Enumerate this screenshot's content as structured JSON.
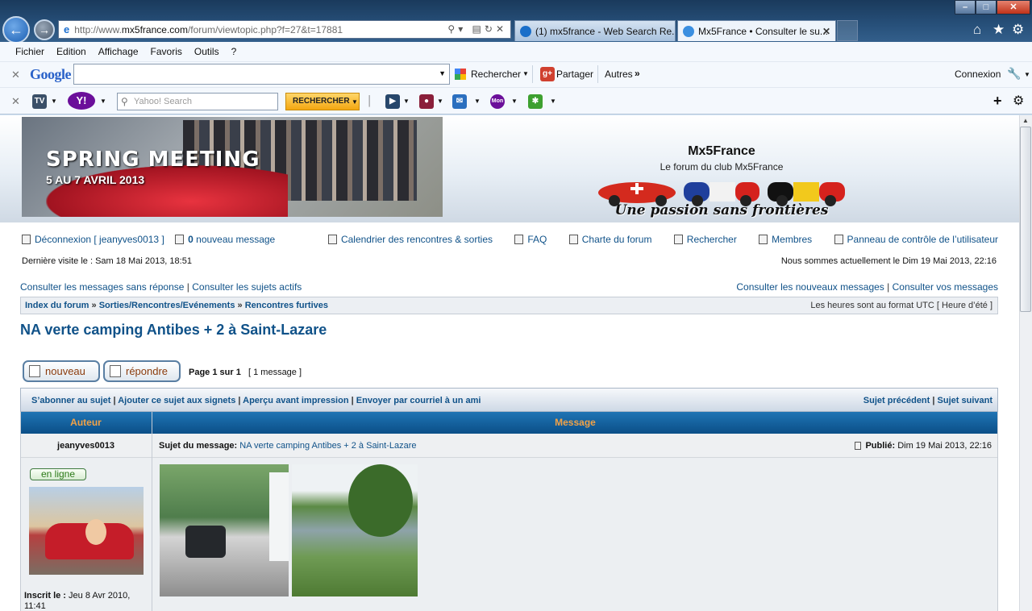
{
  "browser": {
    "url_prefix": "http://www.",
    "url_domain": "mx5france.com",
    "url_rest": "/forum/viewtopic.php?f=27&t=17881",
    "tabs": [
      {
        "label": "(1) mx5france - Web Search Re..."
      },
      {
        "label": "Mx5France • Consulter le su..."
      }
    ],
    "menu": [
      "Fichier",
      "Edition",
      "Affichage",
      "Favoris",
      "Outils",
      "?"
    ]
  },
  "google_toolbar": {
    "logo": "Google",
    "search_label": "Rechercher",
    "share_label": "Partager",
    "more_label": "Autres",
    "connect_label": "Connexion"
  },
  "yahoo_toolbar": {
    "search_placeholder": "Yahoo! Search",
    "search_button": "RECHERCHER",
    "tv_label": "TV",
    "mon_label": "Mon"
  },
  "header": {
    "banner_title": "SPRING MEETING",
    "banner_dates": "5 AU 7 AVRIL 2013",
    "site_title": "Mx5France",
    "site_desc": "Le forum du club Mx5France",
    "slogan": "Une passion sans frontières"
  },
  "nav": {
    "logout": "Déconnexion [ jeanyves0013 ]",
    "new_msg_count": "0",
    "new_msg_label": " nouveau message",
    "links": [
      "Calendrier des rencontres & sorties",
      "FAQ",
      "Charte du forum",
      "Rechercher",
      "Membres",
      "Panneau de contrôle de l’utilisateur"
    ],
    "last_visit": "Dernière visite le : Sam 18 Mai 2013, 18:51",
    "current_time": "Nous sommes actuellement le Dim 19 Mai 2013, 22:16",
    "unanswered": "Consulter les messages sans réponse",
    "active": "Consulter les sujets actifs",
    "new_posts": "Consulter les nouveaux messages",
    "your_posts": "Consulter vos messages"
  },
  "breadcrumb": {
    "items": [
      "Index du forum",
      "Sorties/Rencontres/Evénements",
      "Rencontres furtives"
    ],
    "timezone": "Les heures sont au format UTC [ Heure d’été ]"
  },
  "topic": {
    "title": "NA verte camping Antibes + 2 à Saint-Lazare",
    "btn_new": "nouveau",
    "btn_reply": "répondre",
    "page_info": "Page 1 sur 1",
    "msg_count": "[ 1 message ]",
    "actions": [
      "S’abonner au sujet",
      "Ajouter ce sujet aux signets",
      "Aperçu avant impression",
      "Envoyer par courriel à un ami"
    ],
    "prev": "Sujet précédent",
    "next": "Sujet suivant"
  },
  "post": {
    "col_author": "Auteur",
    "col_message": "Message",
    "author": "jeanyves0013",
    "subject_label": "Sujet du message:",
    "subject": "NA verte camping Antibes + 2 à Saint-Lazare",
    "published_label": "Publié:",
    "published": "Dim 19 Mai 2013, 22:16",
    "online": "en ligne",
    "joined_label": "Inscrit le :",
    "joined": "Jeu 8 Avr 2010, 11:41"
  }
}
